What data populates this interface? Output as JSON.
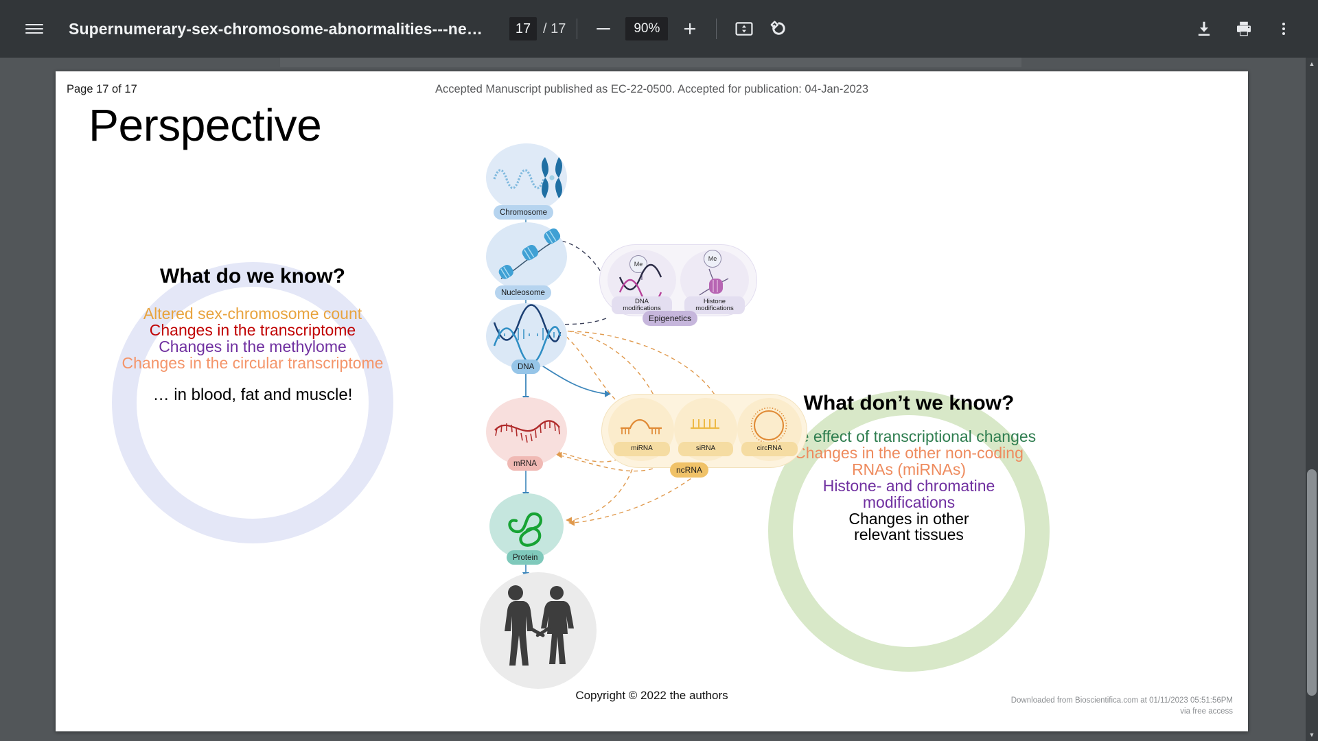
{
  "toolbar": {
    "menu_icon": "hamburger-menu-icon",
    "title": "Supernumerary-sex-chromosome-abnormalities---new-develop…",
    "page_current": "17",
    "page_total": "/ 17",
    "zoom_out_icon": "minus-icon",
    "zoom_level": "90%",
    "zoom_in_icon": "plus-icon",
    "fit_icon": "fit-to-page-icon",
    "rotate_icon": "rotate-counterclockwise-icon",
    "download_icon": "download-icon",
    "print_icon": "print-icon",
    "more_icon": "more-vertical-icon"
  },
  "page": {
    "header_left": "Page 17 of 17",
    "header_center": "Accepted Manuscript published as EC-22-0500. Accepted for publication: 04-Jan-2023",
    "title": "Perspective",
    "copyright": "Copyright © 2022 the authors",
    "download_note_line1": "Downloaded from Bioscientifica.com at 01/11/2023 05:51:56PM",
    "download_note_line2": "via free access"
  },
  "left_circle": {
    "title": "What do we know?",
    "lines": [
      {
        "text": "Altered sex-chromosome count",
        "color": "#e8a33d"
      },
      {
        "text": "Changes in the transcriptome",
        "color": "#c00000"
      },
      {
        "text": "Changes in the methylome",
        "color": "#7030a0"
      },
      {
        "text": "Changes in the circular transcriptome",
        "color": "#f4956a"
      }
    ],
    "footer": "… in blood, fat and muscle!",
    "footer_color": "#000000",
    "ring_color": "#e4e7f7"
  },
  "right_circle": {
    "title": "What don’t we know?",
    "lines": [
      {
        "text": "The effect of transcriptional changes",
        "color": "#2e7d4f"
      },
      {
        "text": "Changes in the other non-coding",
        "color": "#ee8b5e"
      },
      {
        "text": "RNAs (miRNAs)",
        "color": "#ee8b5e"
      },
      {
        "text": "Histone- and chromatine",
        "color": "#7030a0"
      },
      {
        "text": "modifications",
        "color": "#7030a0"
      },
      {
        "text": "Changes in other",
        "color": "#000000"
      },
      {
        "text": "relevant tissues",
        "color": "#000000"
      }
    ],
    "ring_color": "#d8e8c8"
  },
  "diagram": {
    "nodes": [
      {
        "id": "chromosome",
        "label": "Chromosome",
        "blob_color": "#dfeaf7",
        "pill_color": "#b6d4ef"
      },
      {
        "id": "nucleosome",
        "label": "Nucleosome",
        "blob_color": "#dbe8f6",
        "pill_color": "#b6d4ef"
      },
      {
        "id": "dna",
        "label": "DNA",
        "blob_color": "#dbe8f6",
        "pill_color": "#96c5e8"
      },
      {
        "id": "mrna",
        "label": "mRNA",
        "blob_color": "#f8dfdd",
        "pill_color": "#f0b9b4"
      },
      {
        "id": "protein",
        "label": "Protein",
        "blob_color": "#c5e6de",
        "pill_color": "#7fc9bb"
      },
      {
        "id": "people",
        "label": "",
        "blob_color": "#ebebeb",
        "pill_color": "#ebebeb"
      }
    ],
    "epigenetics": {
      "group_label": "Epigenetics",
      "group_pill_color": "#c6b6dc",
      "outer_color": "#f6f4f9",
      "items": [
        {
          "label_line1": "DNA",
          "label_line2": "modifications",
          "badge": "Me",
          "blob_color": "#eeeaf5",
          "pill_color": "#e3def0"
        },
        {
          "label_line1": "Histone",
          "label_line2": "modifications",
          "badge": "Me",
          "blob_color": "#eeeaf5",
          "pill_color": "#e3def0"
        }
      ]
    },
    "ncrna": {
      "group_label": "ncRNA",
      "group_pill_color": "#f0c268",
      "outer_color": "#fdf3de",
      "items": [
        {
          "label": "miRNA",
          "blob_color": "#fbeccc",
          "pill_color": "#f5dca2"
        },
        {
          "label": "siRNA",
          "blob_color": "#fbeccc",
          "pill_color": "#f5dca2"
        },
        {
          "label": "circRNA",
          "blob_color": "#fbeccc",
          "pill_color": "#f5dca2"
        }
      ]
    }
  },
  "scrollbar": {
    "up_arrow": "▲",
    "down_arrow": "▼"
  }
}
